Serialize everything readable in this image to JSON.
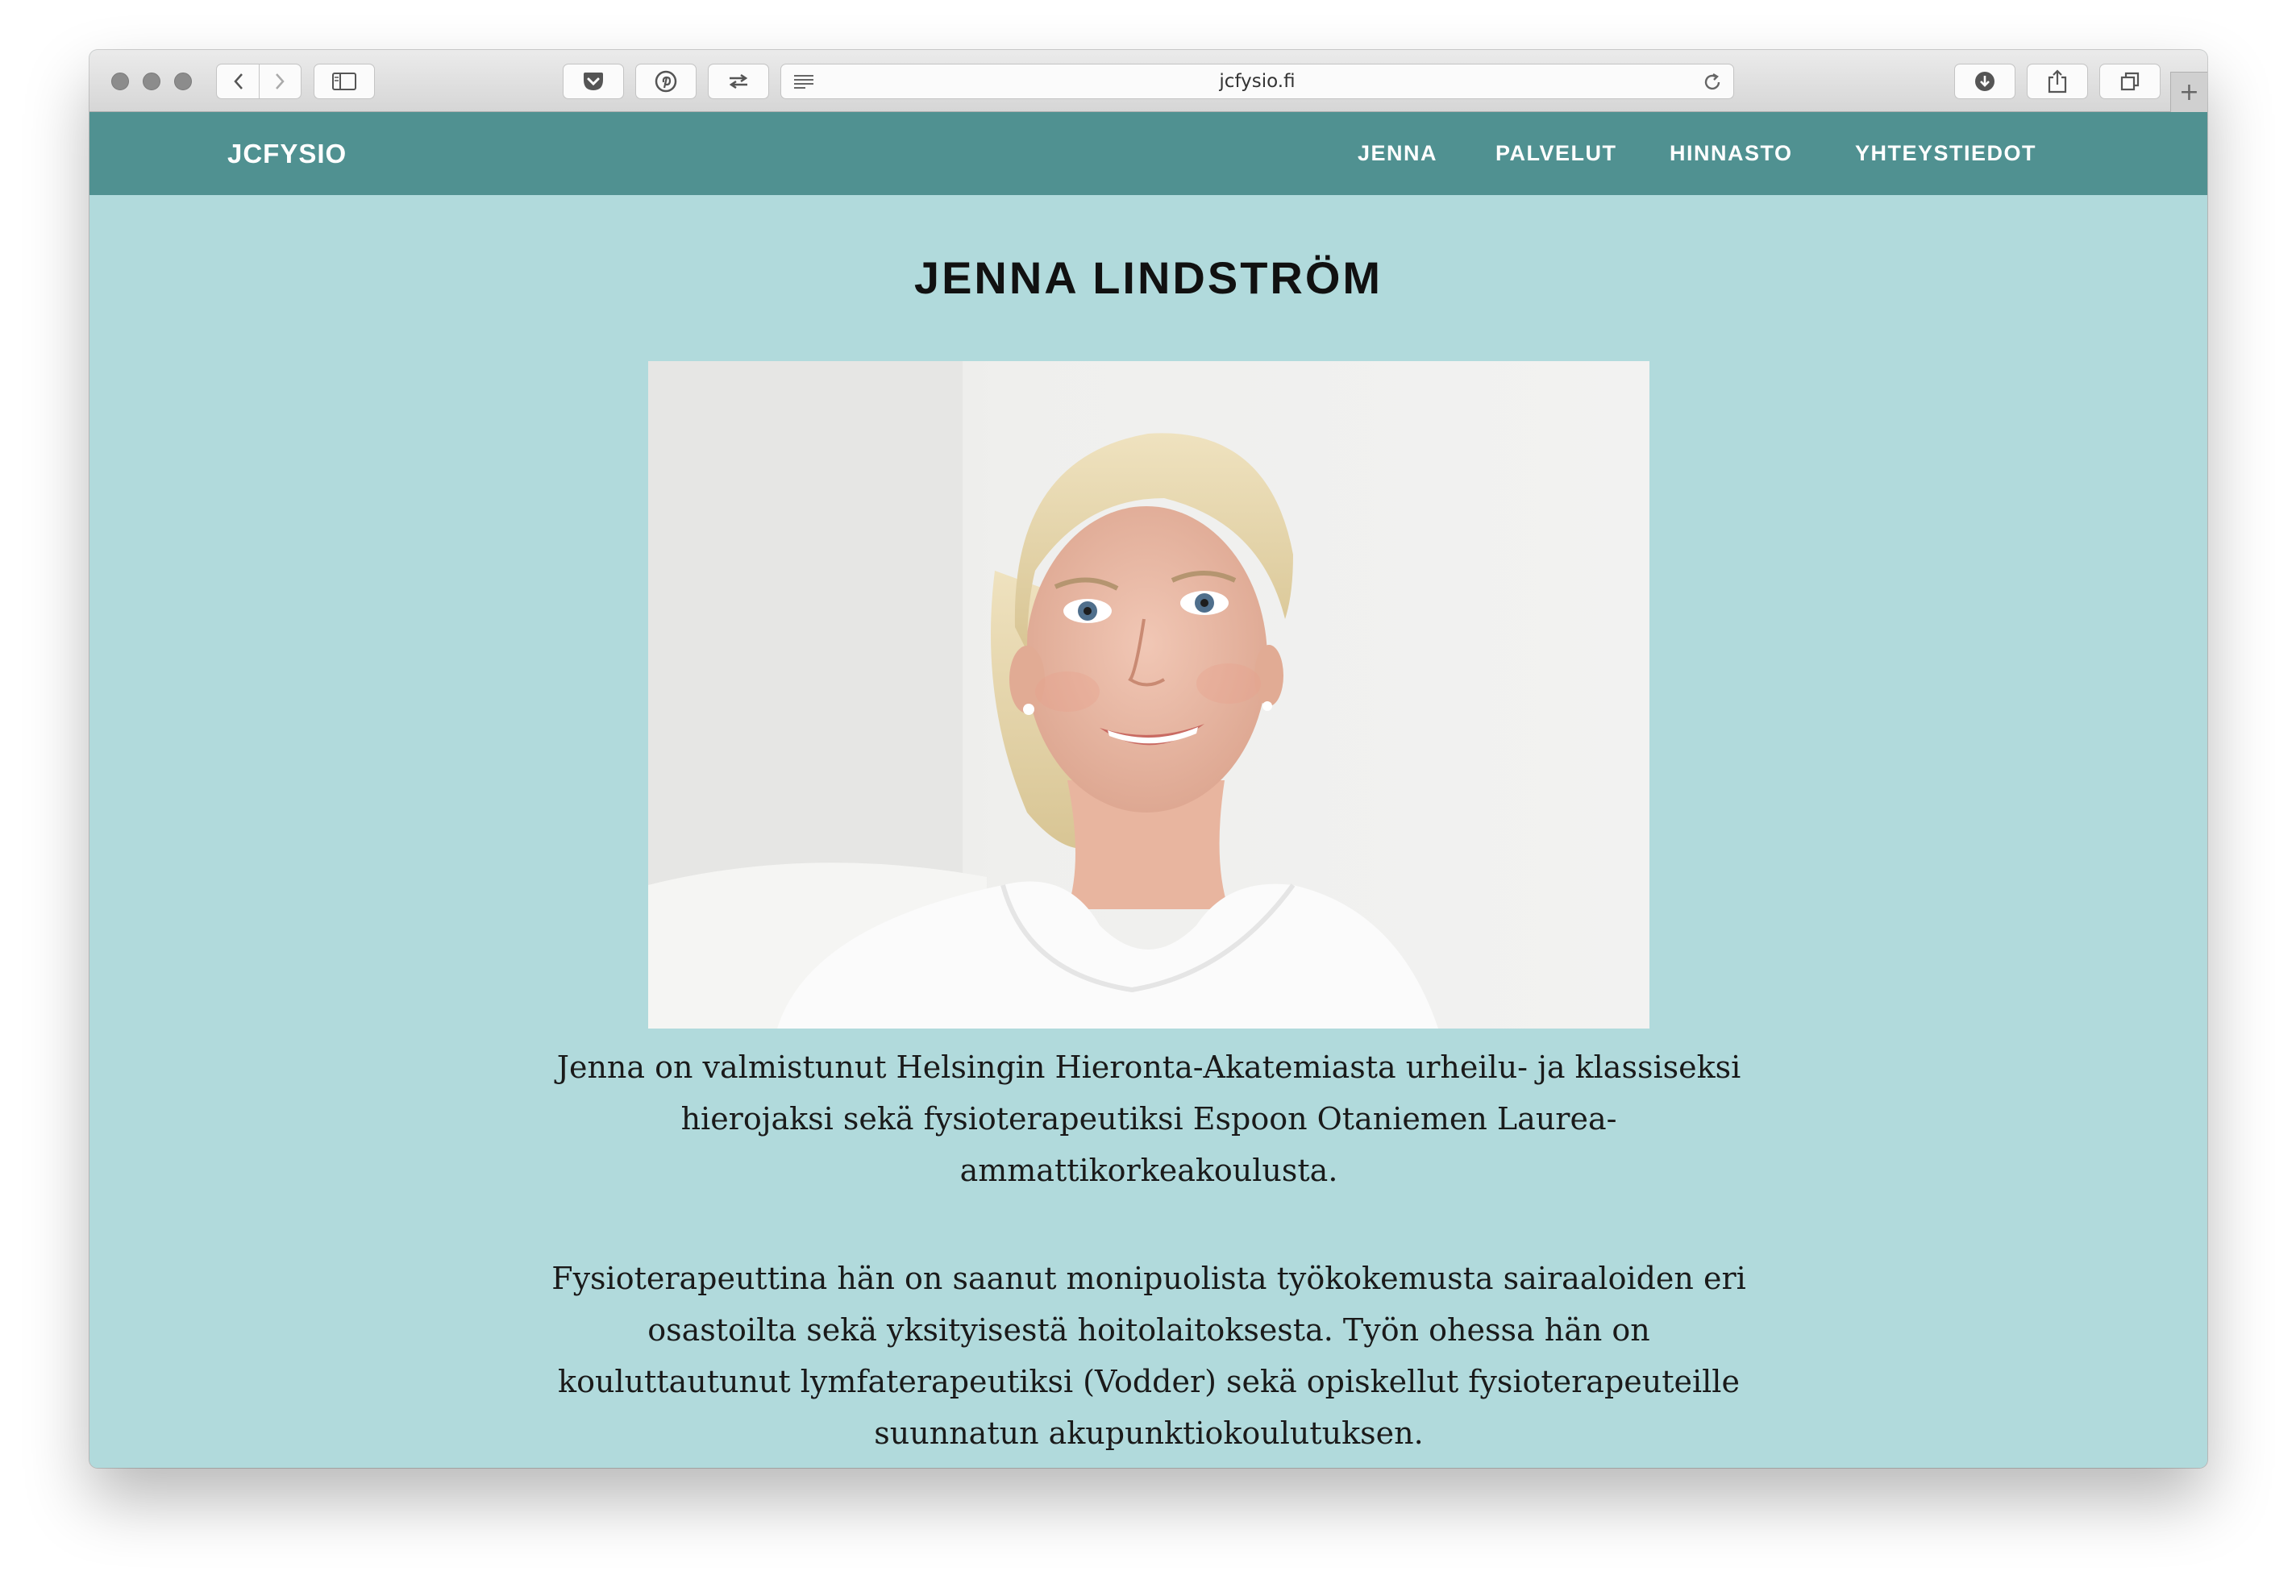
{
  "browser": {
    "url": "jcfysio.fi",
    "new_tab_symbol": "+"
  },
  "site": {
    "brand": "JCFYSIO",
    "nav": [
      "JENNA",
      "PALVELUT",
      "HINNASTO",
      "YHTEYSTIEDOT"
    ]
  },
  "page": {
    "title": "JENNA LINDSTRÖM",
    "paragraphs": [
      "Jenna on valmistunut Helsingin Hieronta-Akatemiasta urheilu- ja klassiseksi hierojaksi sekä fysioterapeutiksi Espoon Otaniemen Laurea-ammattikorkeakoulusta.",
      "Fysioterapeuttina hän on saanut monipuolista työkokemusta sairaaloiden eri osastoilta sekä yksityisestä hoitolaitoksesta. Työn ohessa hän on kouluttautunut lymfaterapeutiksi (Vodder) sekä opiskellut fysioterapeuteille suunnatun akupunktiokoulutuksen."
    ]
  },
  "colors": {
    "navbar": "#509191",
    "page_background": "#b1dadc"
  }
}
